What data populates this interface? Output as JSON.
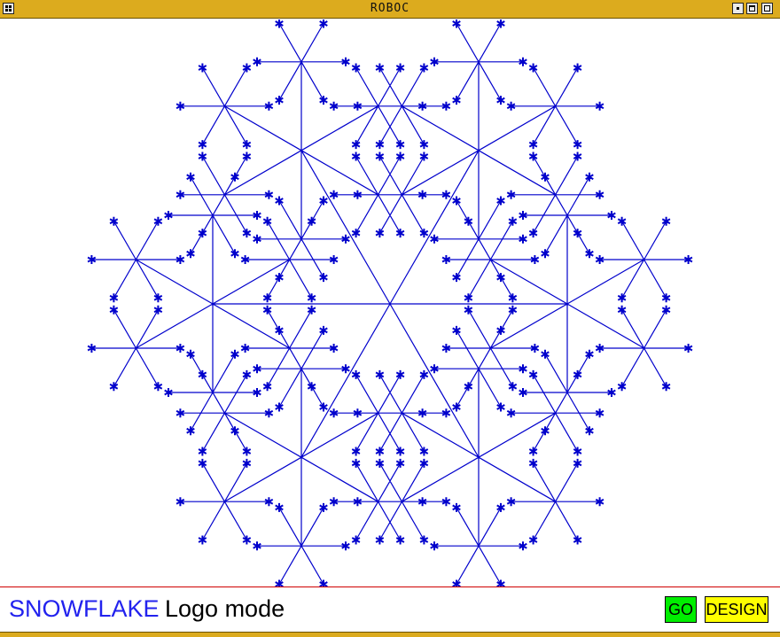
{
  "window": {
    "title": "ROBOC"
  },
  "canvas": {
    "stroke_color": "#0000cc",
    "background": "#ffffff",
    "fractal": "snowflake",
    "depth": 3
  },
  "status": {
    "program_name": "SNOWFLAKE",
    "mode_label": "Logo mode",
    "program_color": "#2222ee"
  },
  "buttons": {
    "go": "GO",
    "design": "DESIGN",
    "go_color": "#00ee00",
    "design_color": "#ffff00"
  },
  "colors": {
    "title_bar": "#dcab1e",
    "divider": "#d00000"
  }
}
